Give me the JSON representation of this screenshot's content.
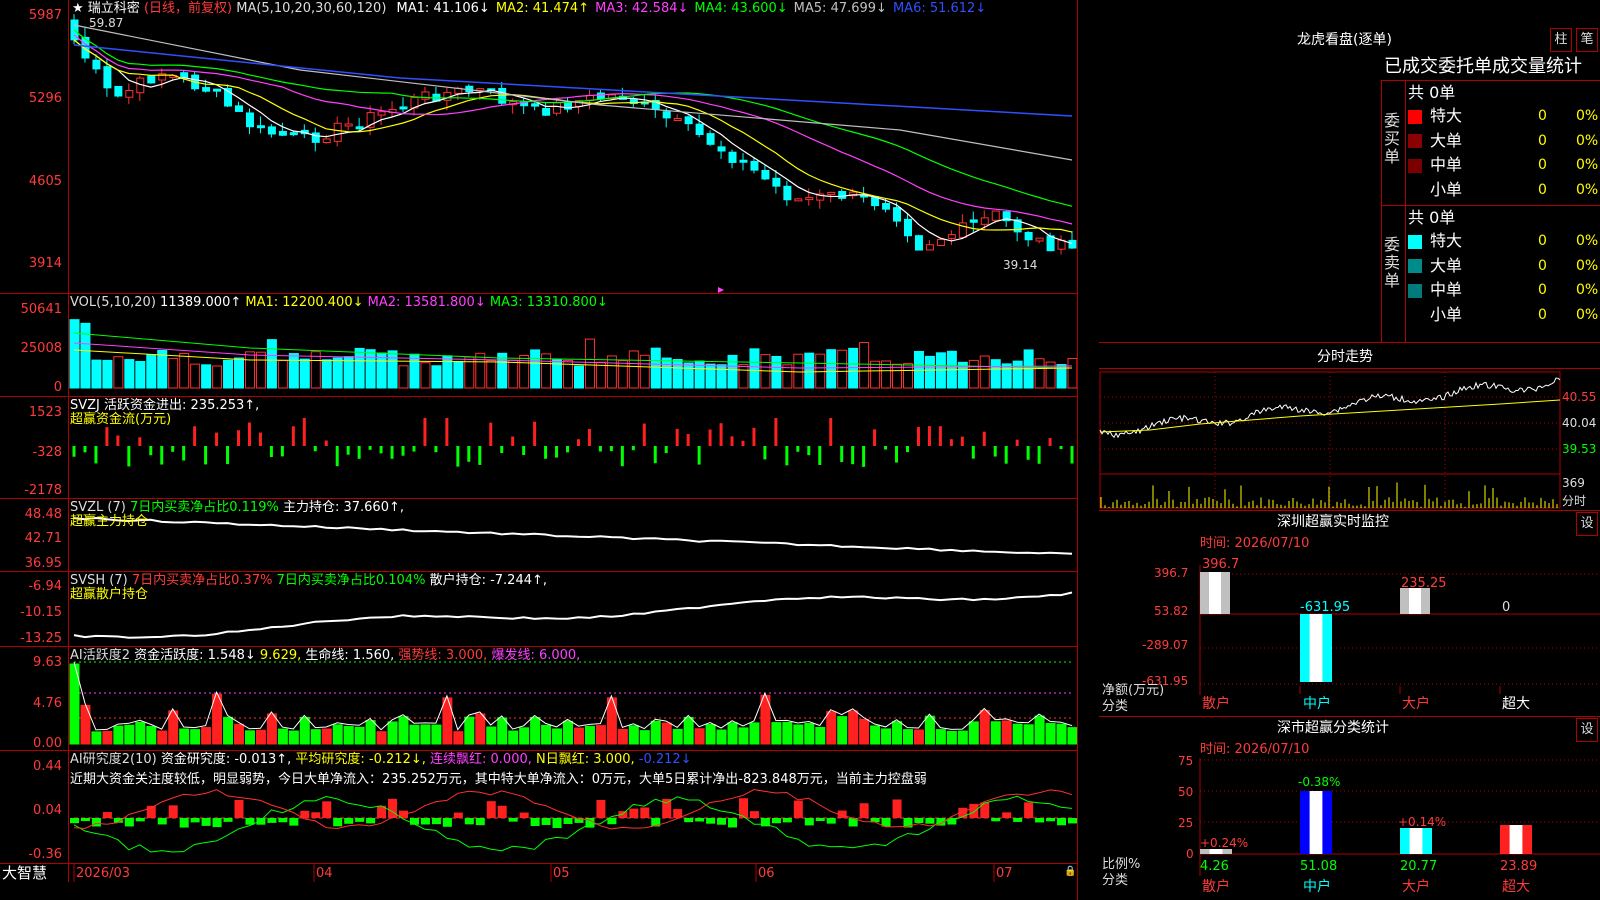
{
  "main": {
    "y_labels": [
      "5987",
      "5296",
      "4605",
      "3914"
    ],
    "high_marker": "59.87",
    "low_marker": "39.14",
    "title": "★ 瑞立科密",
    "period": "(日线，前复权)",
    "ma_header": "MA(5,10,20,30,60,120)",
    "ma": [
      {
        "label": "MA1: 41.106↓",
        "color": "#ffffff"
      },
      {
        "label": "MA2: 41.474↑",
        "color": "#ffff00"
      },
      {
        "label": "MA3: 42.584↓",
        "color": "#ff40ff"
      },
      {
        "label": "MA4: 43.600↓",
        "color": "#00ff00"
      },
      {
        "label": "MA5: 47.699↓",
        "color": "#c0c0c0"
      },
      {
        "label": "MA6: 51.612↓",
        "color": "#3050ff"
      }
    ]
  },
  "vol": {
    "y_labels": [
      "50641",
      "25008",
      "0"
    ],
    "header": "VOL(5,10,20)",
    "value": "11389.000↑",
    "ma1": "MA1: 12200.400↓",
    "ma2": "MA2: 13581.800↓",
    "ma3": "MA3: 13310.800↓"
  },
  "svzj": {
    "y_labels": [
      "1523",
      "-328",
      "-2178"
    ],
    "header": "SVZJ  活跃资金进出: 235.253↑,",
    "sub": "超赢资金流(万元)"
  },
  "svzl": {
    "y_labels": [
      "48.48",
      "42.71",
      "36.95"
    ],
    "prefix": "SVZL (7)",
    "ratio": "7日内买卖净占比0.119%",
    "hold": "主力持仓: 37.660↑,",
    "sub": "超赢主力持仓"
  },
  "svsh": {
    "y_labels": [
      "-6.94",
      "-10.15",
      "-13.25"
    ],
    "prefix": "SVSH (7)",
    "ratio1": "7日内买卖净占比0.37%",
    "ratio2": "7日内买卖净占比0.104%",
    "hold": "散户持仓: -7.244↑,",
    "sub": "超赢散户持仓"
  },
  "ai1": {
    "y_labels": [
      "9.63",
      "4.76",
      "0.00"
    ],
    "prefix": "AI活跃度2",
    "a": "资金活跃度: 1.548↓",
    "b": "9.629,",
    "c": "生命线: 1.560,",
    "d": "强势线: 3.000,",
    "e": "爆发线: 6.000,"
  },
  "ai2": {
    "y_labels": [
      "0.44",
      "0.04",
      "-0.36"
    ],
    "prefix": "AI研究度2(10)",
    "a": "资金研究度: -0.013↑,",
    "b": "平均研究度: -0.212↓,",
    "c": "连续飘红: 0.000,",
    "d": "N日飘红: 3.000,",
    "e": "-0.212↓",
    "comment": "近期大资金关注度较低，明显弱势，今日大单净流入：235.252万元，其中特大单净流入：0万元，大单5日累计净出-823.848万元，当前主力控盘弱"
  },
  "xaxis": {
    "brand": "大智慧",
    "labels": [
      "2026/03",
      "04",
      "05",
      "06",
      "07"
    ]
  },
  "panel": {
    "title": "龙虎看盘(逐单)",
    "btn1": "柱",
    "btn2": "笔",
    "subtitle": "已成交委托单成交量统计",
    "buy_label": "委买单",
    "sell_label": "委卖单",
    "buy_total": "共 0单",
    "sell_total": "共 0单",
    "buy_rows": [
      {
        "name": "特大",
        "count": "0",
        "pct": "0%",
        "color": "#ff0000"
      },
      {
        "name": "大单",
        "count": "0",
        "pct": "0%",
        "color": "#8b0000"
      },
      {
        "name": "中单",
        "count": "0",
        "pct": "0%",
        "color": "#7a0000"
      },
      {
        "name": "小单",
        "count": "0",
        "pct": "0%",
        "color": "#000000"
      }
    ],
    "sell_rows": [
      {
        "name": "特大",
        "count": "0",
        "pct": "0%",
        "color": "#00ffff"
      },
      {
        "name": "大单",
        "count": "0",
        "pct": "0%",
        "color": "#008b8b"
      },
      {
        "name": "中单",
        "count": "0",
        "pct": "0%",
        "color": "#007a7a"
      },
      {
        "name": "小单",
        "count": "0",
        "pct": "0%",
        "color": "#000000"
      }
    ]
  },
  "intraday": {
    "title": "分时走势",
    "y_labels": [
      "40.55",
      "40.04",
      "39.53"
    ],
    "vol_label": "369",
    "vol_suffix": "分时"
  },
  "sz_monitor": {
    "title": "深圳超赢实时监控",
    "settings": "设",
    "time": "时间: 2026/07/10",
    "y_labels": [
      "396.7",
      "53.82",
      "-289.07",
      "-631.95"
    ],
    "unit_top": "净额(万元)",
    "unit_bottom": "分类",
    "bar_values": [
      "396.7",
      "-631.95",
      "235.25",
      "0"
    ],
    "categories": [
      "散户",
      "中户",
      "大户",
      "超大"
    ]
  },
  "sz_class": {
    "title": "深市超赢分类统计",
    "settings": "设",
    "time": "时间: 2026/07/10",
    "y_labels": [
      "75",
      "50",
      "25",
      "0"
    ],
    "unit_top": "比例%",
    "unit_bottom": "分类",
    "deltas": [
      "+0.24%",
      "-0.38%",
      "+0.14%",
      ""
    ],
    "values": [
      "4.26",
      "51.08",
      "20.77",
      "23.89"
    ],
    "categories": [
      "散户",
      "中户",
      "大户",
      "超大"
    ]
  }
}
